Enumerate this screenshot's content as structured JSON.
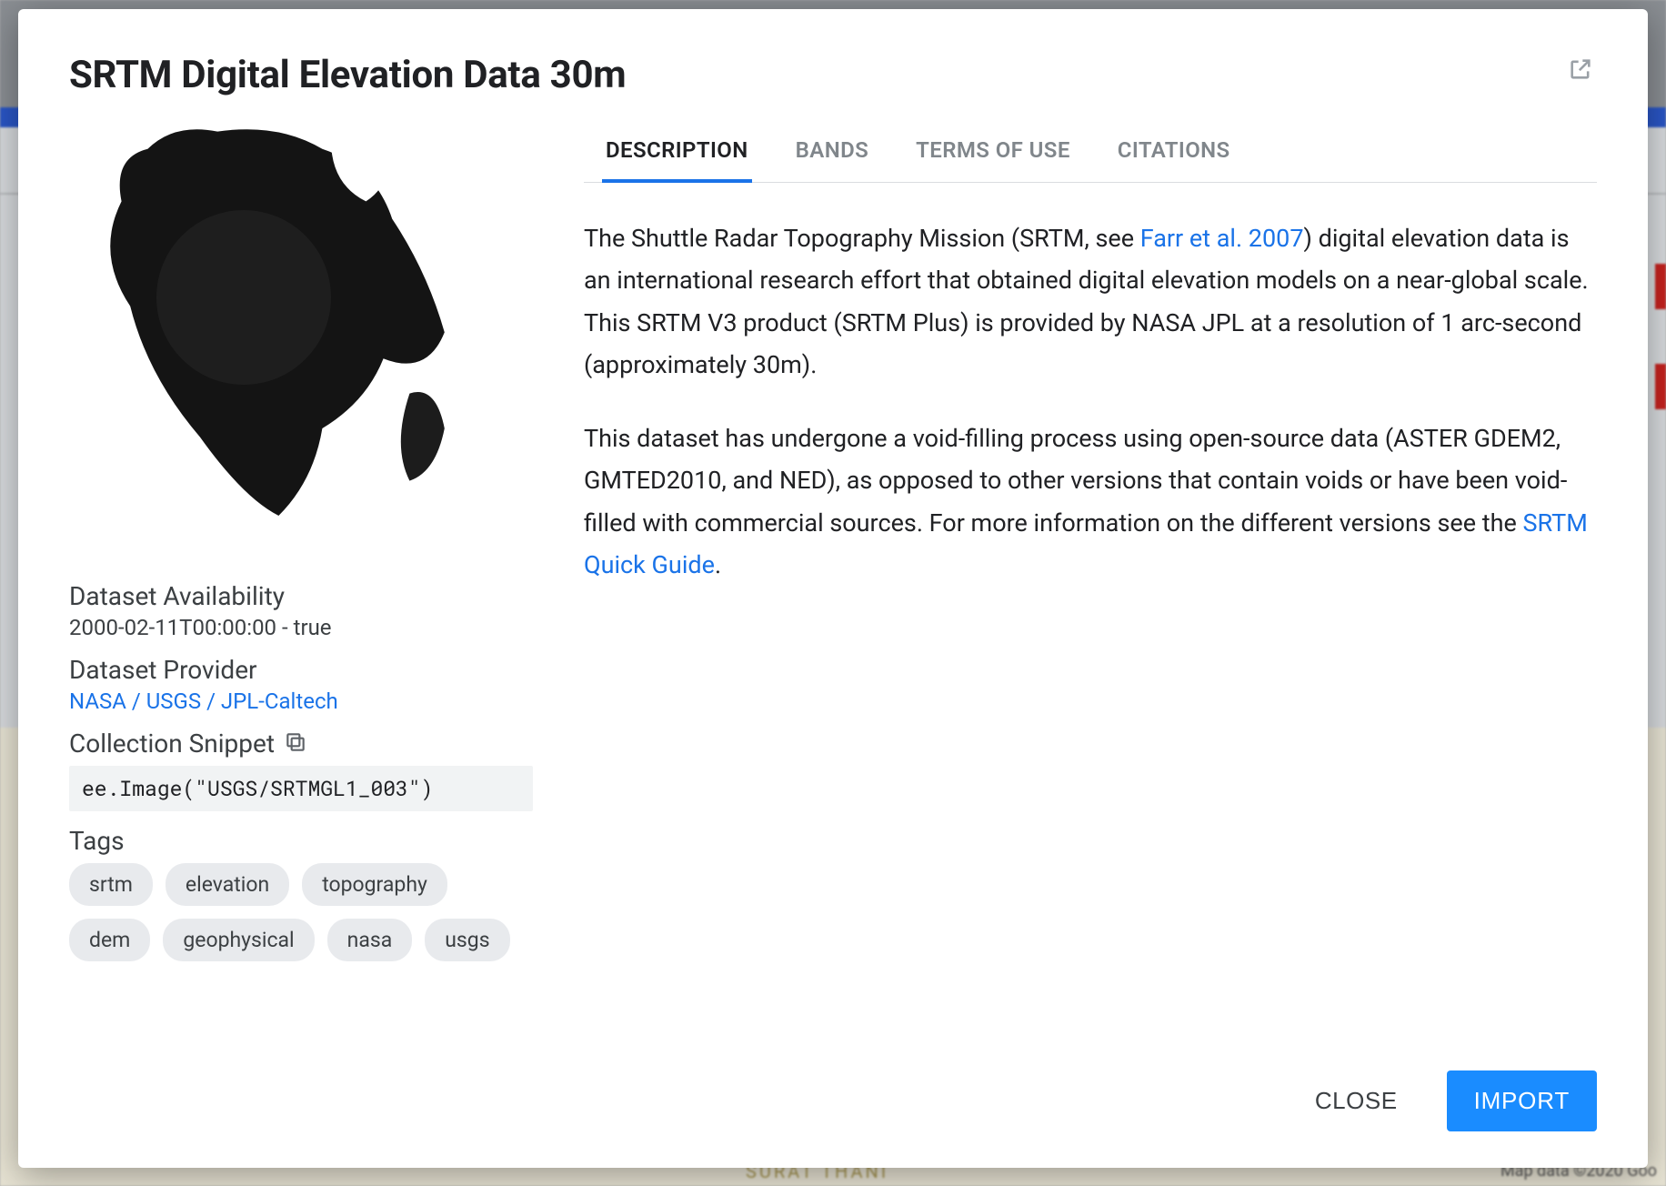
{
  "modal": {
    "title": "SRTM Digital Elevation Data 30m",
    "popout_tooltip": "Open in new window"
  },
  "left": {
    "availability_label": "Dataset Availability",
    "availability_value": "2000-02-11T00:00:00 - true",
    "provider_label": "Dataset Provider",
    "provider_link": "NASA / USGS / JPL-Caltech",
    "snippet_label": "Collection Snippet",
    "snippet_code": "ee.Image(\"USGS/SRTMGL1_003\")",
    "tags_label": "Tags",
    "tags": [
      "srtm",
      "elevation",
      "topography",
      "dem",
      "geophysical",
      "nasa",
      "usgs"
    ]
  },
  "tabs": [
    {
      "id": "description",
      "label": "DESCRIPTION",
      "active": true
    },
    {
      "id": "bands",
      "label": "BANDS",
      "active": false
    },
    {
      "id": "terms",
      "label": "TERMS OF USE",
      "active": false
    },
    {
      "id": "citations",
      "label": "CITATIONS",
      "active": false
    }
  ],
  "description": {
    "p1_a": "The Shuttle Radar Topography Mission (SRTM, see ",
    "p1_link": "Farr et al. 2007",
    "p1_b": ") digital elevation data is an international research effort that obtained digital elevation models on a near-global scale. This SRTM V3 product (SRTM Plus) is provided by NASA JPL at a resolution of 1 arc-second (approximately 30m).",
    "p2_a": "This dataset has undergone a void-filling process using open-source data (ASTER GDEM2, GMTED2010, and NED), as opposed to other versions that contain voids or have been void-filled with commercial sources. For more information on the different versions see the ",
    "p2_link": "SRTM Quick Guide",
    "p2_b": "."
  },
  "footer": {
    "close": "CLOSE",
    "import": "IMPORT"
  },
  "backdrop": {
    "bottom_right": "Map data ©2020 Goo",
    "bottom_label": "SURAT THANI"
  }
}
